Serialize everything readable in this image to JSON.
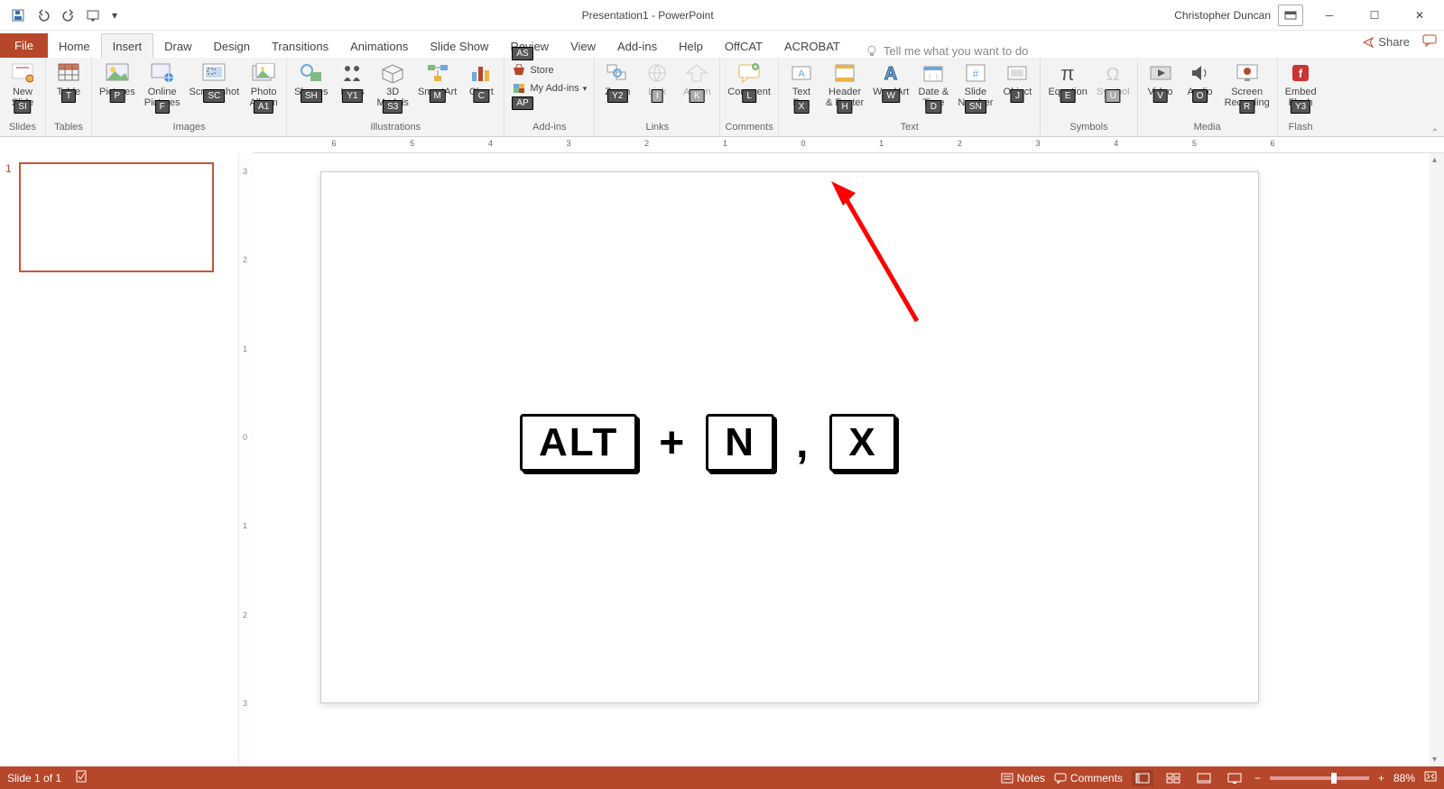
{
  "title": "Presentation1 - PowerPoint",
  "user": "Christopher Duncan",
  "tabs": [
    "File",
    "Home",
    "Insert",
    "Draw",
    "Design",
    "Transitions",
    "Animations",
    "Slide Show",
    "Review",
    "View",
    "Add-ins",
    "Help",
    "OffCAT",
    "ACROBAT"
  ],
  "active_tab": "Insert",
  "tellme": "Tell me what you want to do",
  "share": "Share",
  "ribbon": {
    "slides": {
      "new_slide": "New\nSlide",
      "key": "SI",
      "label": "Slides"
    },
    "tables": {
      "table": "Table",
      "key": "T",
      "label": "Tables"
    },
    "images": {
      "pictures": "Pictures",
      "key_p": "P",
      "online": "Online\nPictures",
      "key_f": "F",
      "screenshot": "Screenshot",
      "key_sc": "SC",
      "album": "Photo\nAlbum",
      "key_a1": "A1",
      "label": "Images"
    },
    "illus": {
      "shapes": "Shapes",
      "key_sh": "SH",
      "icons": "Icons",
      "key_y1": "Y1",
      "models": "3D\nModels",
      "key_s3": "S3",
      "smart": "SmartArt",
      "key_m": "M",
      "chart": "Chart",
      "key_c": "C",
      "label": "Illustrations"
    },
    "addins": {
      "store": "Store",
      "key_as": "AS",
      "my": "My Add-ins",
      "key_ap": "AP",
      "label": "Add-ins"
    },
    "links": {
      "zoom": "Zoom",
      "key_y2": "Y2",
      "link": "Link",
      "key_i": "I",
      "action": "Action",
      "key_k": "K",
      "label": "Links"
    },
    "comments": {
      "comment": "Comment",
      "key_l": "L",
      "label": "Comments"
    },
    "text": {
      "textbox": "Text\nBox",
      "key_x": "X",
      "header": "Header\n& Footer",
      "key_h": "H",
      "wordart": "WordArt",
      "key_w": "W",
      "date": "Date &\nTime",
      "key_d": "D",
      "slidenum": "Slide\nNumber",
      "key_sn": "SN",
      "object": "Object",
      "key_j": "J",
      "label": "Text"
    },
    "symbols": {
      "equation": "Equation",
      "key_e": "E",
      "symbol": "Symbol",
      "key_u": "U",
      "label": "Symbols"
    },
    "media": {
      "video": "Video",
      "key_v": "V",
      "audio": "Audio",
      "key_o": "O",
      "screenrec": "Screen\nRecording",
      "key_r": "R",
      "label": "Media"
    },
    "flash": {
      "embed": "Embed\nFlash",
      "key_y3": "Y3",
      "label": "Flash"
    }
  },
  "ruler": {
    "marks": [
      "6",
      "5",
      "4",
      "3",
      "2",
      "1",
      "0",
      "1",
      "2",
      "3",
      "4",
      "5",
      "6"
    ]
  },
  "vruler": [
    "3",
    "2",
    "1",
    "0",
    "1",
    "2",
    "3"
  ],
  "thumb_num": "1",
  "combo": {
    "alt": "ALT",
    "n": "N",
    "x": "X"
  },
  "status": {
    "slide": "Slide 1 of 1",
    "notes": "Notes",
    "comments": "Comments",
    "zoom": "88%"
  }
}
